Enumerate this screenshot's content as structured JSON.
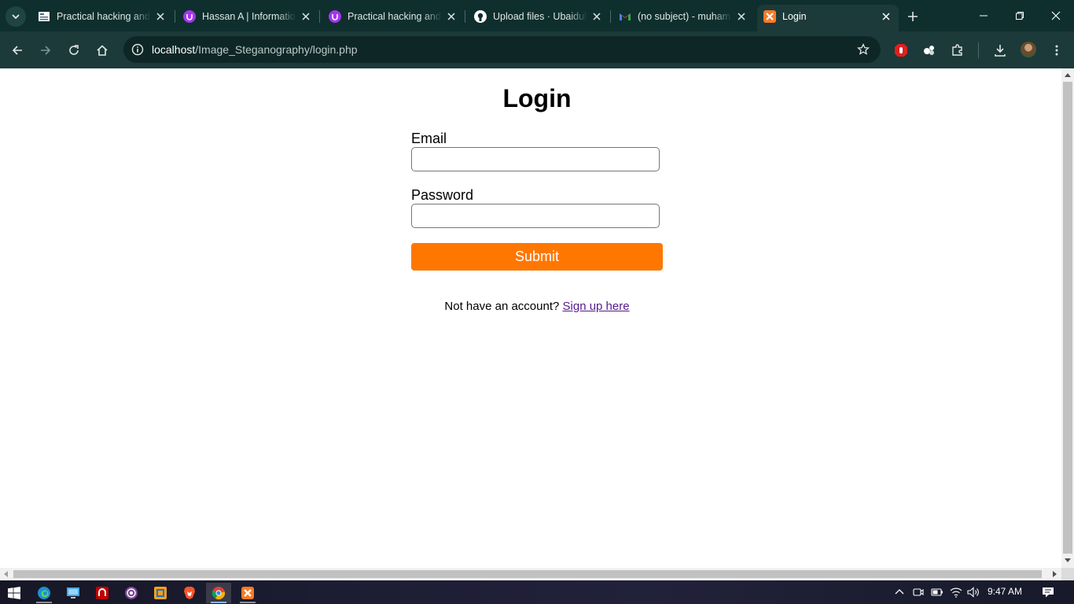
{
  "browser": {
    "tabs": [
      {
        "title": "Practical hacking and",
        "icon": "document-icon",
        "active": false
      },
      {
        "title": "Hassan A | Informatio",
        "icon": "udemy-icon",
        "active": false
      },
      {
        "title": "Practical hacking and",
        "icon": "udemy-icon",
        "active": false
      },
      {
        "title": "Upload files · Ubaidul",
        "icon": "github-icon",
        "active": false
      },
      {
        "title": "(no subject) - muham",
        "icon": "gmail-icon",
        "active": false
      },
      {
        "title": "Login",
        "icon": "xampp-icon",
        "active": true
      }
    ],
    "url_host": "localhost",
    "url_path": "/Image_Steganography/login.php"
  },
  "page": {
    "title": "Login",
    "email_label": "Email",
    "email_value": "",
    "password_label": "Password",
    "password_value": "",
    "submit_label": "Submit",
    "signup_prompt": "Not have an account?",
    "signup_link": "Sign up here"
  },
  "taskbar": {
    "time": "9:47 AM",
    "apps": [
      "windows-start-icon",
      "edge-icon",
      "desktop-icon",
      "filezilla-icon",
      "tor-icon",
      "xampp-control-icon",
      "brave-icon",
      "chrome-icon",
      "xampp-icon"
    ]
  },
  "colors": {
    "tab_strip": "#0e2f2e",
    "toolbar": "#1c3a39",
    "submit": "#ff7700",
    "link": "#551a8b"
  }
}
